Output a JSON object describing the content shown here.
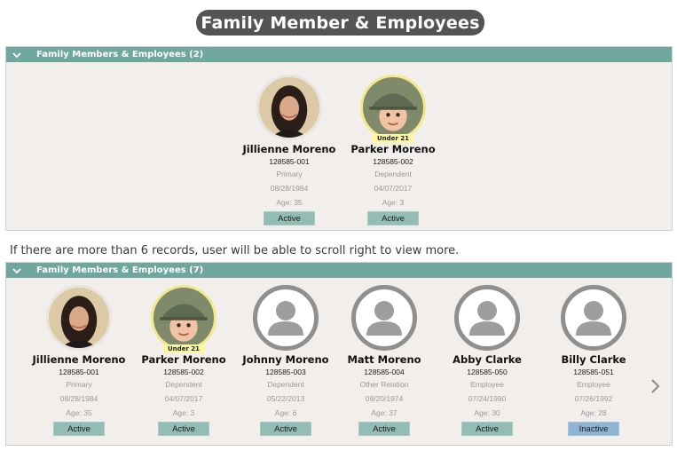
{
  "title": "Family Member & Employees",
  "panel1": {
    "header": "Family Members & Employees (2)",
    "members": [
      {
        "name": "Jillienne Moreno",
        "id": "128585-001",
        "relation": "Primary",
        "dob": "08/28/1984",
        "age": "Age: 35",
        "status": "Active",
        "avatar": "woman-photo",
        "under21": false
      },
      {
        "name": "Parker Moreno",
        "id": "128585-002",
        "relation": "Dependent",
        "dob": "04/07/2017",
        "age": "Age: 3",
        "status": "Active",
        "avatar": "child-photo",
        "under21": true,
        "badge": "Under 21"
      }
    ]
  },
  "note": "If there are more than 6 records, user will be able to scroll right to view more.",
  "panel2": {
    "header": "Family Members & Employees (7)",
    "members": [
      {
        "name": "Jillienne Moreno",
        "id": "128585-001",
        "relation": "Primary",
        "dob": "08/28/1984",
        "age": "Age: 35",
        "status": "Active",
        "avatar": "woman-photo",
        "under21": false
      },
      {
        "name": "Parker Moreno",
        "id": "128585-002",
        "relation": "Dependent",
        "dob": "04/07/2017",
        "age": "Age: 3",
        "status": "Active",
        "avatar": "child-photo",
        "under21": true,
        "badge": "Under 21"
      },
      {
        "name": "Johnny Moreno",
        "id": "128585-003",
        "relation": "Dependent",
        "dob": "05/22/2013",
        "age": "Age: 6",
        "status": "Active",
        "avatar": "person-placeholder-icon",
        "under21": false
      },
      {
        "name": "Matt Moreno",
        "id": "128585-004",
        "relation": "Other Relation",
        "dob": "09/20/1974",
        "age": "Age: 37",
        "status": "Active",
        "avatar": "person-placeholder-icon",
        "under21": false
      },
      {
        "name": "Abby Clarke",
        "id": "128585-050",
        "relation": "Employee",
        "dob": "07/24/1990",
        "age": "Age: 30",
        "status": "Active",
        "avatar": "person-placeholder-icon",
        "under21": false
      },
      {
        "name": "Billy Clarke",
        "id": "128585-051",
        "relation": "Employee",
        "dob": "07/26/1992",
        "age": "Age: 28",
        "status": "Inactive",
        "avatar": "person-placeholder-icon",
        "under21": false
      }
    ]
  },
  "icons": {
    "collapse": "chevron-down-icon",
    "scroll": "chevron-right-icon"
  },
  "colors": {
    "header": "#6fa79f",
    "panel_bg": "#f1eeeb",
    "active": "#92bcb4",
    "inactive": "#8fb3d3",
    "under21_badge": "#fbf6a7"
  }
}
